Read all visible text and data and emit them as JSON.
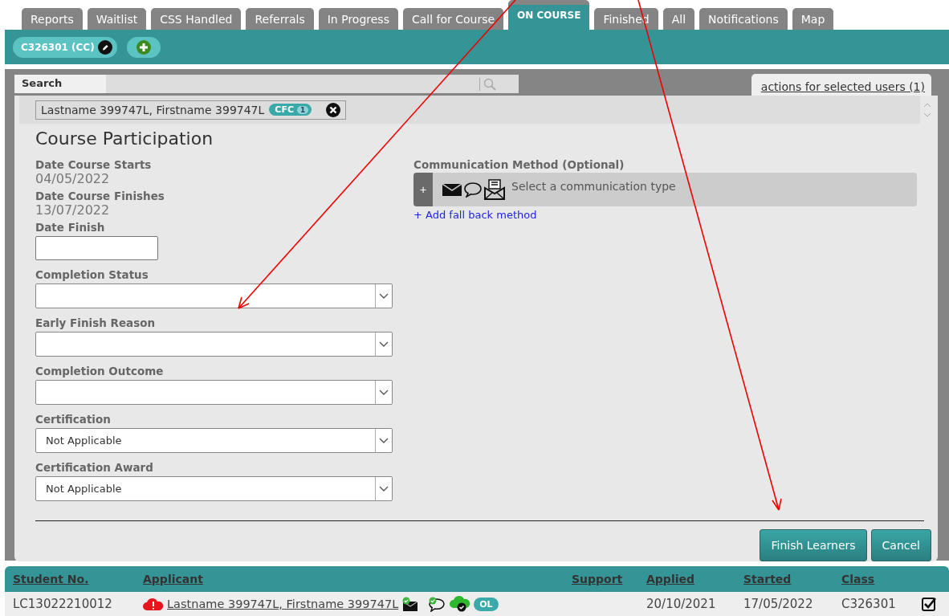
{
  "tabs": [
    {
      "label": "Reports",
      "selected": false
    },
    {
      "label": "Waitlist",
      "selected": false
    },
    {
      "label": "CSS Handled",
      "selected": false
    },
    {
      "label": "Referrals",
      "selected": false
    },
    {
      "label": "In Progress",
      "selected": false
    },
    {
      "label": "Call for Course",
      "selected": false
    },
    {
      "label": "ON COURSE",
      "selected": true
    },
    {
      "label": "Finished",
      "selected": false
    },
    {
      "label": "All",
      "selected": false
    },
    {
      "label": "Notifications",
      "selected": false
    },
    {
      "label": "Map",
      "selected": false
    }
  ],
  "course_chip": {
    "label": "C326301 (CC)"
  },
  "search": {
    "label": "Search"
  },
  "actions_link": "actions for selected users (1)",
  "selected_users": [
    {
      "name": "Lastname 399747L, Firstname 399747L",
      "badge": "CFC",
      "count": "1"
    }
  ],
  "form": {
    "title": "Course Participation",
    "fields": [
      {
        "kind": "readonly",
        "label": "Date Course Starts",
        "value": "04/05/2022"
      },
      {
        "kind": "readonly",
        "label": "Date Course Finishes",
        "value": "13/07/2022"
      },
      {
        "kind": "date",
        "label": "Date Finish"
      },
      {
        "kind": "select",
        "label": "Completion Status"
      },
      {
        "kind": "select",
        "label": "Early Finish Reason"
      },
      {
        "kind": "select",
        "label": "Completion Outcome"
      },
      {
        "kind": "select",
        "label": "Certification",
        "value": "Not Applicable"
      },
      {
        "kind": "select",
        "label": "Certification Award",
        "value": "Not Applicable"
      }
    ],
    "communication": {
      "label": "Communication Method (Optional)",
      "add_symbol": "+",
      "placeholder": "Select a communication type",
      "fallback_link": "+ Add fall back method"
    },
    "buttons": [
      "Finish Learners",
      "Cancel"
    ]
  },
  "table": {
    "columns": [
      "Student No.",
      "Applicant",
      "Support",
      "Applied",
      "Started",
      "Class"
    ],
    "rows": [
      {
        "student_no": "LC13022210012",
        "applicant": "Lastname 399747L, Firstname 399747L",
        "badge": "OL",
        "applied": "20/10/2021",
        "started": "17/05/2022",
        "class": "C326301",
        "checked": true
      }
    ]
  }
}
